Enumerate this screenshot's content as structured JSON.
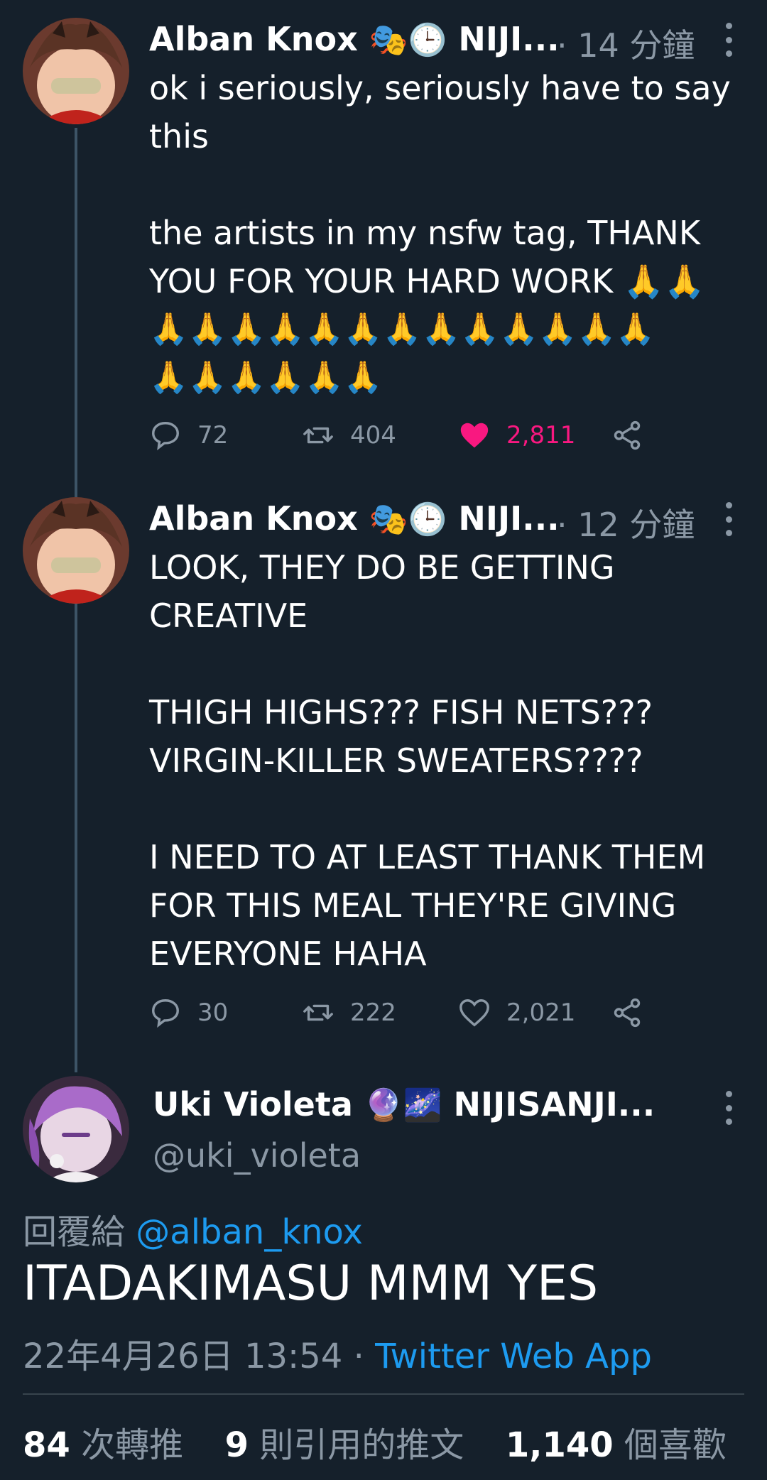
{
  "tweets": [
    {
      "author": "Alban Knox",
      "author_suffix": "NIJI...",
      "time": "· 14 分鐘",
      "text_lines": [
        "ok i seriously, seriously have to say",
        "this",
        "",
        "the artists in my nsfw tag, THANK",
        "YOU FOR YOUR HARD WORK 🙏🙏",
        "🙏🙏🙏🙏🙏🙏🙏🙏🙏🙏🙏🙏🙏",
        "🙏🙏🙏🙏🙏🙏"
      ],
      "replies": "72",
      "retweets": "404",
      "likes": "2,811",
      "liked": true
    },
    {
      "author": "Alban Knox",
      "author_suffix": "NIJI...",
      "time": "· 12 分鐘",
      "text_lines": [
        "LOOK, THEY DO BE GETTING",
        "CREATIVE",
        "",
        "THIGH HIGHS??? FISH NETS???",
        "VIRGIN-KILLER SWEATERS????",
        "",
        "I NEED TO AT LEAST THANK THEM",
        "FOR THIS MEAL THEY'RE GIVING",
        "EVERYONE HAHA"
      ],
      "replies": "30",
      "retweets": "222",
      "likes": "2,021",
      "liked": false
    }
  ],
  "main_tweet": {
    "author": "Uki Violeta",
    "author_suffix": "NIJISANJI...",
    "handle": "@uki_violeta",
    "reply_prefix": "回覆給",
    "reply_to": "@alban_knox",
    "text": "ITADAKIMASU MMM YES",
    "date": "22年4月26日 13:54",
    "separator": "·",
    "source": "Twitter Web App",
    "retweets_count": "84",
    "retweets_label": "次轉推",
    "quotes_count": "9",
    "quotes_label": "則引用的推文",
    "likes_count": "1,140",
    "likes_label": "個喜歡"
  },
  "colors": {
    "background": "#15202b",
    "secondary_text": "#8b98a5",
    "link": "#1d9bf0",
    "like": "#f91880",
    "thread_line": "#3d5466"
  }
}
